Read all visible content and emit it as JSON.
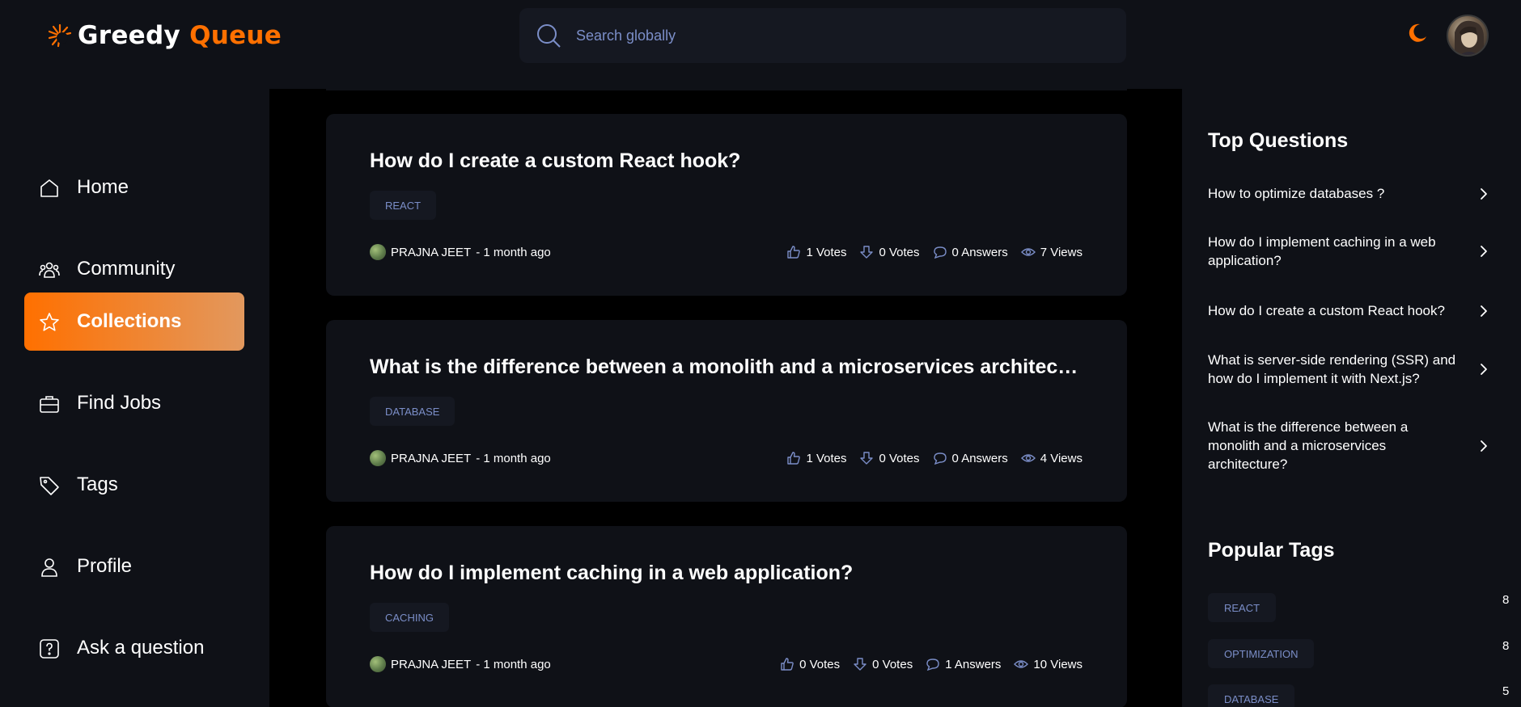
{
  "brand": {
    "name_part1": "Greedy",
    "name_part2": "Queue",
    "accent": "#ff7000"
  },
  "search": {
    "placeholder": "Search globally"
  },
  "header_icons": {
    "theme": "moon-icon",
    "avatar": "user-avatar"
  },
  "sidebar": {
    "items": [
      {
        "label": "Home",
        "icon": "home-icon",
        "active": false
      },
      {
        "label": "Community",
        "icon": "community-icon",
        "active": false
      },
      {
        "label": "Collections",
        "icon": "star-icon",
        "active": true
      },
      {
        "label": "Find Jobs",
        "icon": "briefcase-icon",
        "active": false
      },
      {
        "label": "Tags",
        "icon": "tag-icon",
        "active": false
      },
      {
        "label": "Profile",
        "icon": "user-icon",
        "active": false
      },
      {
        "label": "Ask a question",
        "icon": "question-icon",
        "active": false
      }
    ]
  },
  "questions": [
    {
      "title": "How do I create a custom React hook?",
      "tag": "REACT",
      "author": "PRAJNA JEET",
      "time": "- 1 month ago",
      "upvotes": "1 Votes",
      "downvotes": "0 Votes",
      "answers": "0 Answers",
      "views": "7 Views"
    },
    {
      "title": "What is the difference between a monolith and a microservices architecture?",
      "tag": "DATABASE",
      "author": "PRAJNA JEET",
      "time": "- 1 month ago",
      "upvotes": "1 Votes",
      "downvotes": "0 Votes",
      "answers": "0 Answers",
      "views": "4 Views"
    },
    {
      "title": "How do I implement caching in a web application?",
      "tag": "CACHING",
      "author": "PRAJNA JEET",
      "time": "- 1 month ago",
      "upvotes": "0 Votes",
      "downvotes": "0 Votes",
      "answers": "1 Answers",
      "views": "10 Views"
    }
  ],
  "top_questions": {
    "title": "Top Questions",
    "items": [
      "How to optimize databases ?",
      "How do I implement caching in a web application?",
      "How do I create a custom React hook?",
      "What is server-side rendering (SSR) and how do I implement it with Next.js?",
      "What is the difference between a monolith and a microservices architecture?"
    ]
  },
  "popular_tags": {
    "title": "Popular Tags",
    "items": [
      {
        "name": "REACT",
        "count": "8"
      },
      {
        "name": "OPTIMIZATION",
        "count": "8"
      },
      {
        "name": "DATABASE",
        "count": "5"
      }
    ]
  }
}
